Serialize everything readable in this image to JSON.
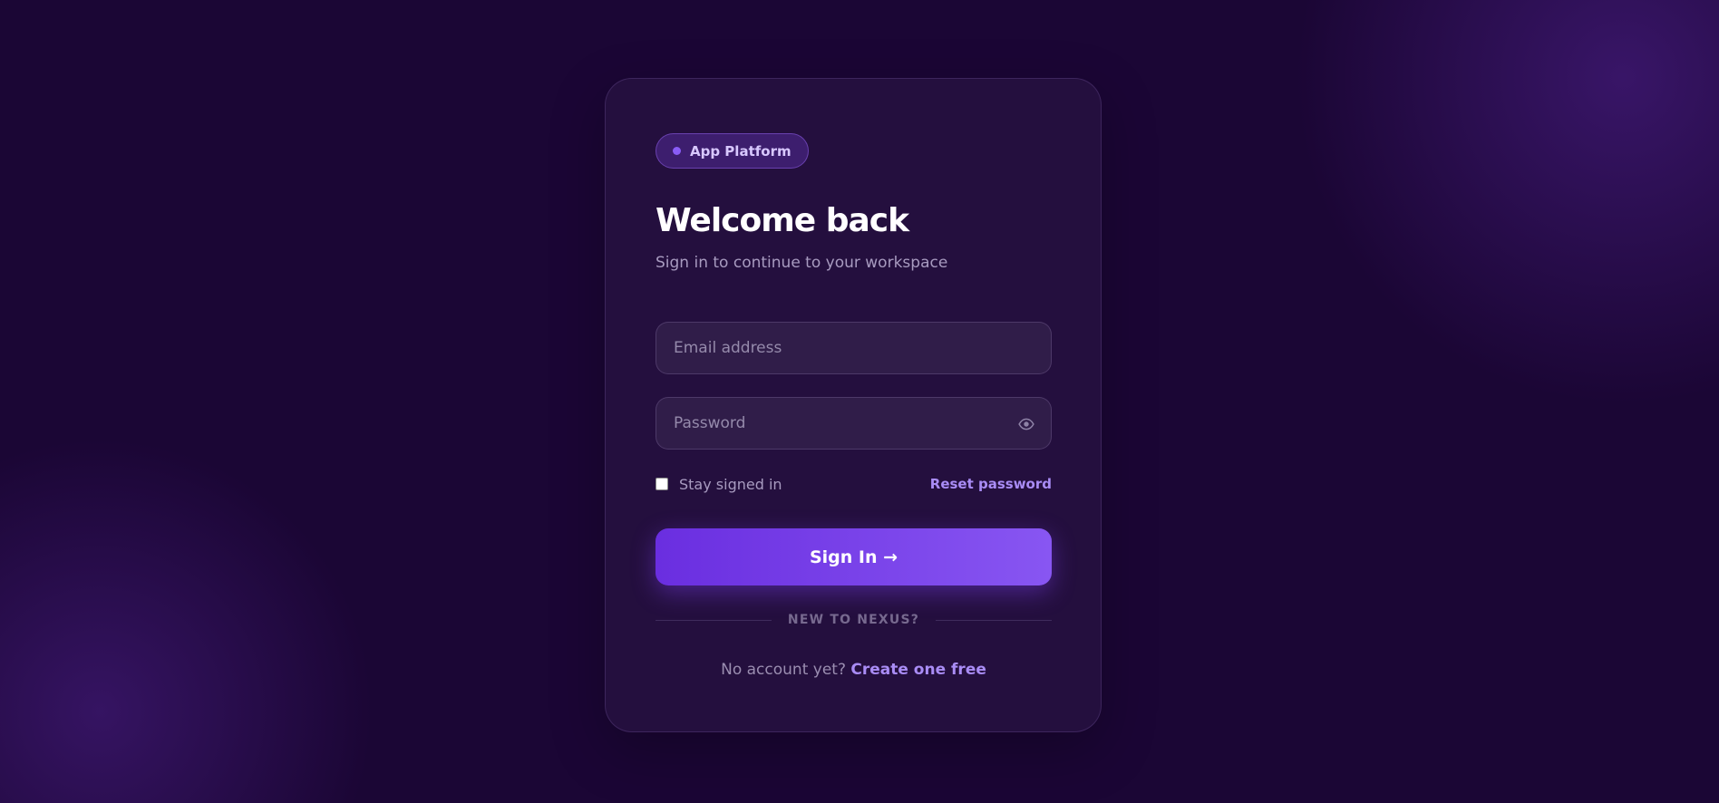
{
  "badge": {
    "label": "App Platform"
  },
  "heading": {
    "title": "Welcome back",
    "subtitle": "Sign in to continue to your workspace"
  },
  "form": {
    "email": {
      "placeholder": "Email address",
      "value": ""
    },
    "password": {
      "placeholder": "Password",
      "value": ""
    },
    "remember_label": "Stay signed in",
    "remember_checked": false,
    "reset_label": "Reset password",
    "submit_label": "Sign In →"
  },
  "divider": {
    "label": "NEW TO NEXUS?"
  },
  "signup": {
    "prompt": "No account yet?",
    "link_label": "Create one free"
  },
  "icons": {
    "badge": "status-dot-icon",
    "password_toggle": "eye-icon"
  },
  "colors": {
    "background": "#1b0635",
    "card": "#25133f",
    "accent": "#8856f2",
    "accent_dark": "#6a2ee0",
    "link": "#a98cf5",
    "muted_text": "#a89bc0"
  }
}
